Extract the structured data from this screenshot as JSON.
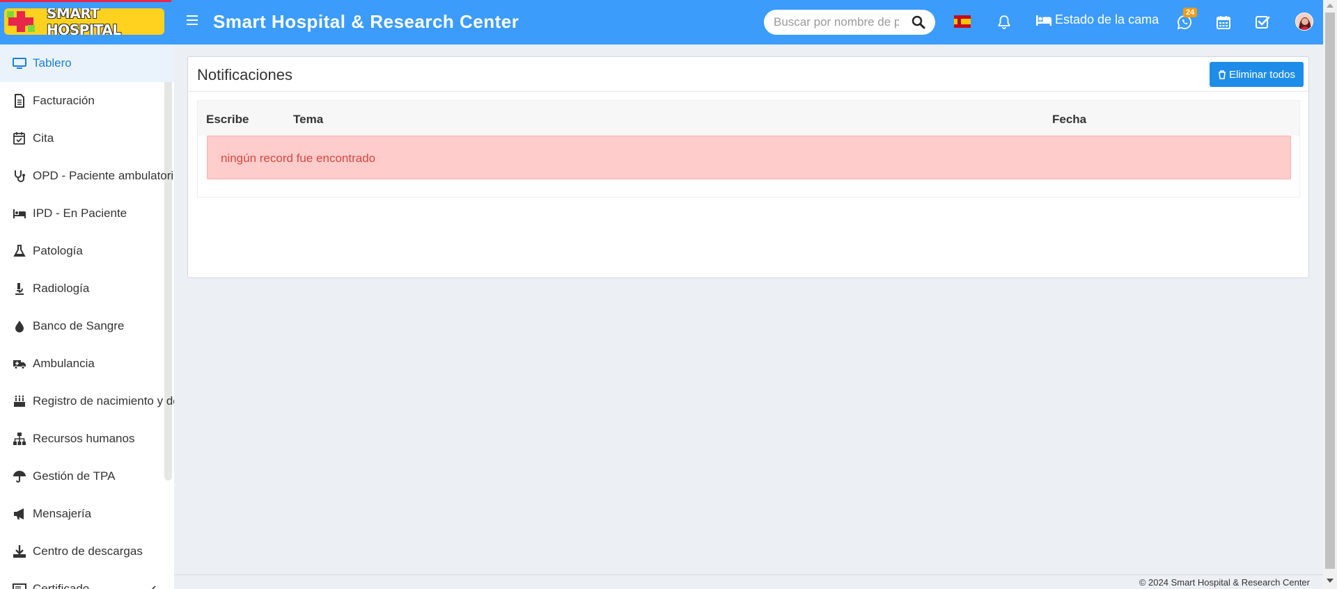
{
  "header": {
    "logo_text": "SMART HOSPITAL",
    "title": "Smart Hospital & Research Center",
    "search_placeholder": "Buscar por nombre de p",
    "bed_status_label": "Estado de la cama",
    "whatsapp_badge": "24",
    "accent_color": "#3c9cfb"
  },
  "sidebar": {
    "items": [
      {
        "label": "Tablero",
        "icon": "monitor-icon",
        "active": true
      },
      {
        "label": "Facturación",
        "icon": "invoice-icon"
      },
      {
        "label": "Cita",
        "icon": "calendar-check-icon"
      },
      {
        "label": "OPD - Paciente ambulatorio",
        "icon": "stethoscope-icon"
      },
      {
        "label": "IPD - En Paciente",
        "icon": "bed-icon"
      },
      {
        "label": "Patología",
        "icon": "flask-icon"
      },
      {
        "label": "Radiología",
        "icon": "microscope-icon"
      },
      {
        "label": "Banco de Sangre",
        "icon": "blood-drop-icon"
      },
      {
        "label": "Ambulancia",
        "icon": "ambulance-icon"
      },
      {
        "label": "Registro de nacimiento y de",
        "icon": "birthday-cake-icon"
      },
      {
        "label": "Recursos humanos",
        "icon": "sitemap-icon"
      },
      {
        "label": "Gestión de TPA",
        "icon": "umbrella-icon"
      },
      {
        "label": "Mensajería",
        "icon": "megaphone-icon"
      },
      {
        "label": "Centro de descargas",
        "icon": "download-icon"
      },
      {
        "label": "Certificado",
        "icon": "certificate-icon"
      }
    ]
  },
  "main": {
    "title": "Notificaciones",
    "delete_all_label": "Eliminar todos",
    "columns": [
      "Escribe",
      "Tema",
      "Fecha"
    ],
    "empty_message": "ningún record fue encontrado"
  },
  "footer": {
    "copyright": "© 2024 Smart Hospital & Research Center"
  }
}
